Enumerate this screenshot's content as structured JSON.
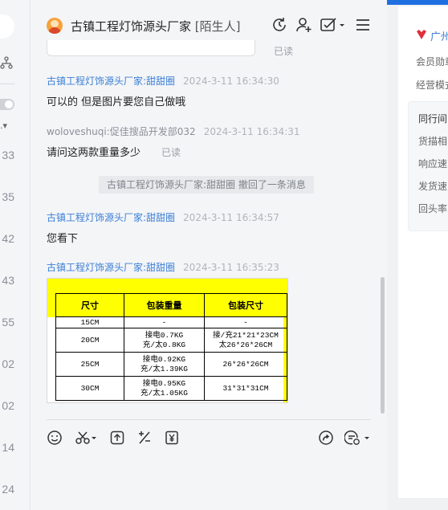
{
  "left_strip": {
    "numbers": [
      "33",
      "35",
      "42",
      "43",
      "55",
      "02",
      "02",
      "14",
      "24"
    ]
  },
  "chat": {
    "header": {
      "title": "古镇工程灯饰源头厂家",
      "stranger_tag": "[陌生人]",
      "icons": [
        "refresh-icon",
        "add-contact-icon",
        "task-check-icon",
        "menu-icon"
      ]
    },
    "read_label": "已读",
    "messages": [
      {
        "sender": "古镇工程灯饰源头厂家:甜甜圈",
        "time": "2024-3-11 16:34:30",
        "text": "可以的 但是图片要您自己做哦"
      },
      {
        "sender": "woloveshuqi:促佳搜品开发部032",
        "time": "2024-3-11 16:34:31",
        "text": "请问这两款重量多少",
        "read": "已读"
      },
      {
        "sender": "古镇工程灯饰源头厂家:甜甜圈",
        "time": "2024-3-11 16:34:57",
        "text": "您看下"
      },
      {
        "sender": "古镇工程灯饰源头厂家:甜甜圈",
        "time": "2024-3-11 16:35:23"
      }
    ],
    "recall_notice": "古镇工程灯饰源头厂家:甜甜圈 撤回了一条消息",
    "product_table": {
      "headers": [
        "尺寸",
        "包装重量",
        "包装尺寸"
      ],
      "rows": [
        {
          "size": "15CM",
          "weight": [
            "-"
          ],
          "pack": [
            "-"
          ]
        },
        {
          "size": "20CM",
          "weight": [
            "接电0.7KG",
            "充/太0.8KG"
          ],
          "pack": [
            "接/充21*21*23CM",
            "太26*26*26CM"
          ]
        },
        {
          "size": "25CM",
          "weight": [
            "接电0.92KG",
            "充/太1.39KG"
          ],
          "pack": [
            "26*26*26CM"
          ]
        },
        {
          "size": "30CM",
          "weight": [
            "接电0.95KG",
            "充/太1.05KG"
          ],
          "pack": [
            "31*31*31CM"
          ]
        }
      ]
    },
    "toolbar": {
      "left_icons": [
        "emoji-icon",
        "scissors-icon",
        "upload-icon",
        "percent-icon",
        "yuan-icon"
      ],
      "right_icons": [
        "share-icon",
        "clock-settings-icon"
      ]
    }
  },
  "right_panel": {
    "city": "广州",
    "line1": "会员勋章",
    "line2": "经营模式",
    "box_title": "同行间",
    "box_lines": [
      "货描相",
      "响应速",
      "发货速",
      "回头率"
    ]
  },
  "colors": {
    "accent": "#3b7fd6",
    "table_yellow": "#ffff00",
    "top_bar": "#1f6fe0"
  }
}
